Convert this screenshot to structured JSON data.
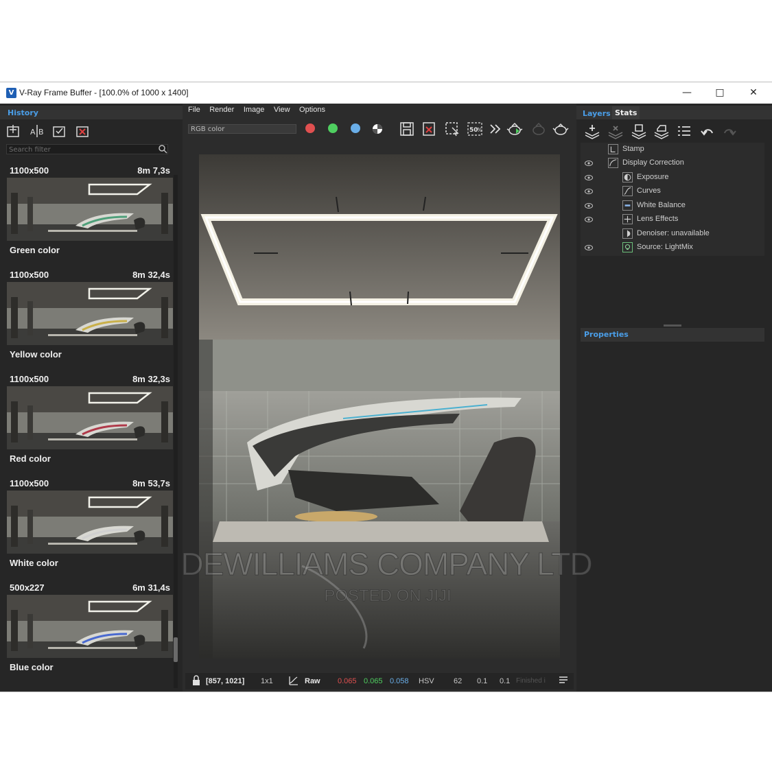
{
  "window": {
    "title": "V-Ray Frame Buffer - [100.0% of 1000 x 1400]",
    "app_icon": "V"
  },
  "history": {
    "tab_label": "History",
    "toolbar_icons": [
      "save-to-history-icon",
      "ab-compare-icon",
      "load-from-history-icon",
      "remove-from-history-icon"
    ],
    "search_placeholder": "Search filter",
    "items": [
      {
        "resolution": "1100x500",
        "time": "8m 7,3s",
        "name": "Green color",
        "accent": "#4fa07a"
      },
      {
        "resolution": "1100x500",
        "time": "8m 32,4s",
        "name": "Yellow color",
        "accent": "#c9b04a"
      },
      {
        "resolution": "1100x500",
        "time": "8m 32,3s",
        "name": "Red color",
        "accent": "#b03a4a"
      },
      {
        "resolution": "1100x500",
        "time": "8m 53,7s",
        "name": "White color",
        "accent": "#d0d0d0"
      },
      {
        "resolution": "500x227",
        "time": "6m 31,4s",
        "name": "Blue color",
        "accent": "#4a6ad0"
      }
    ]
  },
  "menu": [
    "File",
    "Render",
    "Image",
    "View",
    "Options"
  ],
  "toolbar": {
    "channel": "RGB color",
    "dot_colors": [
      "#e05050",
      "#4fcf60",
      "#6aaee8"
    ],
    "zoom_label": "50%"
  },
  "statusbar": {
    "coords": "[857, 1021]",
    "sample": "1x1",
    "mode": "Raw",
    "r": "0.065",
    "g": "0.065",
    "b": "0.058",
    "colorspace": "HSV",
    "h": "62",
    "s": "0.1",
    "v": "0.1",
    "status": "Finished i",
    "colors": {
      "r": "#e05050",
      "g": "#4fcf60",
      "b": "#6aaee8"
    }
  },
  "layers": {
    "tab_layers": "Layers",
    "tab_stats": "Stats",
    "items": [
      {
        "label": "Stamp",
        "eye": false,
        "indent": 0
      },
      {
        "label": "Display Correction",
        "eye": true,
        "indent": 0
      },
      {
        "label": "Exposure",
        "eye": true,
        "indent": 1
      },
      {
        "label": "Curves",
        "eye": true,
        "indent": 1
      },
      {
        "label": "White Balance",
        "eye": true,
        "indent": 1
      },
      {
        "label": "Lens Effects",
        "eye": true,
        "indent": 1
      },
      {
        "label": "Denoiser: unavailable",
        "eye": false,
        "indent": 1
      },
      {
        "label": "Source: LightMix",
        "eye": true,
        "indent": 1
      }
    ],
    "properties_label": "Properties"
  },
  "watermark": {
    "main": "DEWILLIAMS COMPANY LTD",
    "sub": "POSTED ON JIJI"
  }
}
